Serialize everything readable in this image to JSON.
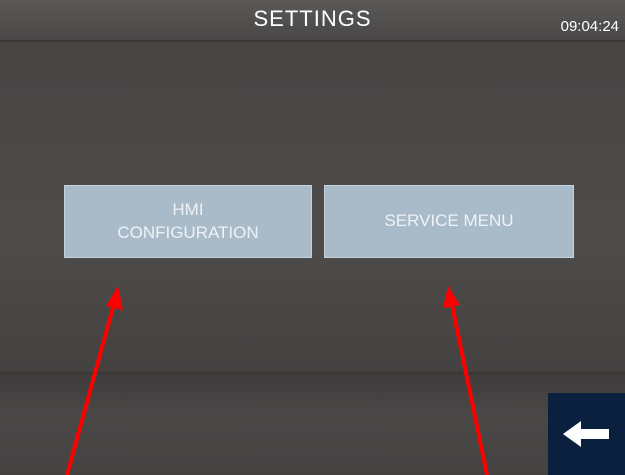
{
  "header": {
    "title": "SETTINGS",
    "time": "09:04:24"
  },
  "buttons": {
    "hmi_line1": "HMI",
    "hmi_line2": "CONFIGURATION",
    "service": "SERVICE MENU"
  },
  "icons": {
    "back": "back-arrow-icon",
    "annotation": "red-arrow-icon"
  },
  "colors": {
    "background": "#494745",
    "button": "#a9bac8",
    "back_button": "#0b1f3f",
    "annotation": "#ff0000"
  }
}
